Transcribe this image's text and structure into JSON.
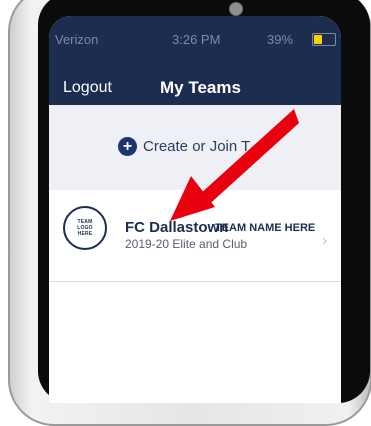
{
  "status_bar": {
    "carrier": "Verizon",
    "time": "3:26 PM",
    "battery": "39%"
  },
  "nav": {
    "logout_label": "Logout",
    "title": "My Teams"
  },
  "create_join": {
    "label": "Create or Join T",
    "icon": "plus-circle-icon"
  },
  "team": {
    "name": "FC Dallastown",
    "name_hint": "TEAM NAME HERE",
    "season": "2019-20 Elite and Club",
    "logo_text": [
      "TEAM",
      "LOGO",
      "HERE"
    ]
  },
  "colors": {
    "navbar": "#1d2d4f",
    "accent": "#1d3470",
    "annotation": "#e8000e"
  }
}
